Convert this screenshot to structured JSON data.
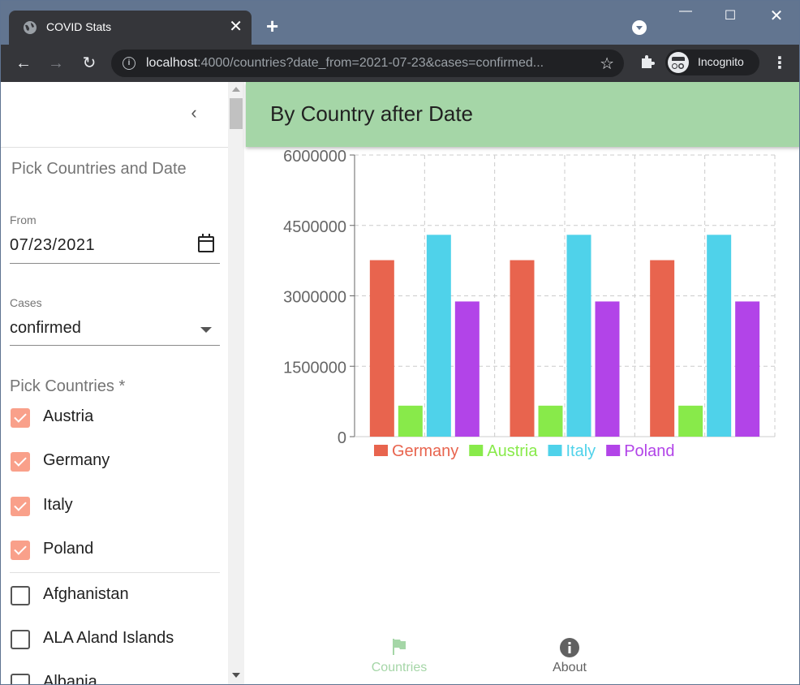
{
  "browser": {
    "tab_title": "COVID Stats",
    "url_host": "localhost",
    "url_rest": ":4000/countries?date_from=2021-07-23&cases=confirmed...",
    "profile_label": "Incognito"
  },
  "sidebar": {
    "title": "Pick Countries and Date",
    "from_label": "From",
    "from_value": "07/23/2021",
    "cases_label": "Cases",
    "cases_value": "confirmed",
    "countries_label": "Pick Countries *",
    "checked": [
      "Austria",
      "Germany",
      "Italy",
      "Poland"
    ],
    "unchecked": [
      "Afghanistan",
      "ALA Aland Islands",
      "Albania"
    ]
  },
  "main": {
    "title": "By Country after Date"
  },
  "bottom_nav": {
    "items": [
      {
        "label": "Countries",
        "icon": "flag-icon",
        "active": true
      },
      {
        "label": "About",
        "icon": "info-icon",
        "active": false
      }
    ]
  },
  "colors": {
    "accent_green": "#a5d6a7",
    "checkbox": "#f9a08a"
  },
  "chart_data": {
    "type": "bar",
    "categories": [
      "",
      "",
      ""
    ],
    "series": [
      {
        "name": "Germany",
        "values": [
          3760000,
          3760000,
          3760000
        ],
        "color": "#e8644e"
      },
      {
        "name": "Austria",
        "values": [
          660000,
          660000,
          660000
        ],
        "color": "#88ea4a"
      },
      {
        "name": "Italy",
        "values": [
          4300000,
          4300000,
          4300000
        ],
        "color": "#4fd2ea"
      },
      {
        "name": "Poland",
        "values": [
          2880000,
          2880000,
          2880000
        ],
        "color": "#b244e8"
      }
    ],
    "yticks": [
      "0",
      "1500000",
      "3000000",
      "4500000",
      "6000000"
    ],
    "ylim": [
      0,
      6000000
    ],
    "grid": true,
    "legend": "bottom"
  }
}
